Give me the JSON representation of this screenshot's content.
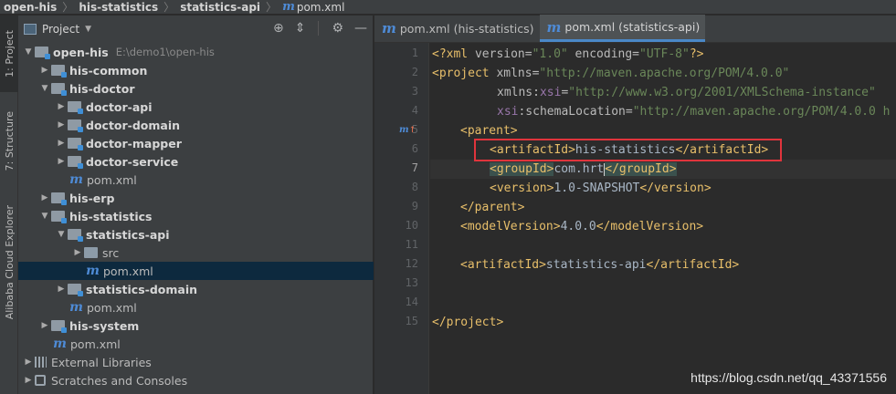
{
  "breadcrumb": {
    "items": [
      "open-his",
      "his-statistics",
      "statistics-api",
      "pom.xml"
    ]
  },
  "tool_stripe": {
    "tabs": [
      "1: Project",
      "7: Structure",
      "Alibaba Cloud Explorer"
    ]
  },
  "project_panel": {
    "title": "Project",
    "tree": [
      {
        "label": "open-his",
        "path": "E:\\demo1\\open-his"
      },
      {
        "label": "his-common"
      },
      {
        "label": "his-doctor"
      },
      {
        "label": "doctor-api"
      },
      {
        "label": "doctor-domain"
      },
      {
        "label": "doctor-mapper"
      },
      {
        "label": "doctor-service"
      },
      {
        "label": "pom.xml"
      },
      {
        "label": "his-erp"
      },
      {
        "label": "his-statistics"
      },
      {
        "label": "statistics-api"
      },
      {
        "label": "src"
      },
      {
        "label": "pom.xml"
      },
      {
        "label": "statistics-domain"
      },
      {
        "label": "pom.xml"
      },
      {
        "label": "his-system"
      },
      {
        "label": "pom.xml"
      },
      {
        "label": "External Libraries"
      },
      {
        "label": "Scratches and Consoles"
      }
    ]
  },
  "editor": {
    "tabs": [
      "pom.xml (his-statistics)",
      "pom.xml (statistics-api)"
    ],
    "active_tab": 1,
    "line_numbers": [
      "1",
      "2",
      "3",
      "4",
      "5",
      "6",
      "7",
      "8",
      "9",
      "10",
      "11",
      "12",
      "13",
      "14",
      "15"
    ],
    "gutter_marker": "m",
    "code": {
      "l1_decl": "<?xml",
      "l1_attr1": " version=",
      "l1_val1": "\"1.0\"",
      "l1_attr2": " encoding=",
      "l1_val2": "\"UTF-8\"",
      "l1_end": "?>",
      "l2_tag": "<project",
      "l2_attr": " xmlns=",
      "l2_val": "\"http://maven.apache.org/POM/4.0.0\"",
      "l3_attr": "xmlns:",
      "l3_ns": "xsi",
      "l3_eq": "=",
      "l3_val": "\"http://www.w3.org/2001/XMLSchema-instance\"",
      "l4_ns": "xsi",
      "l4_attr": ":schemaLocation=",
      "l4_val": "\"http://maven.apache.org/POM/4.0.0 h",
      "l5_tag": "<parent>",
      "l6_open": "<artifactId>",
      "l6_text": "his-statistics",
      "l6_close": "</artifactId>",
      "l7_open": "<groupId>",
      "l7_text": "com.hrt",
      "l7_close": "</groupId>",
      "l8_open": "<version>",
      "l8_text": "1.0-SNAPSHOT",
      "l8_close": "</version>",
      "l9_tag": "</parent>",
      "l10_open": "<modelVersion>",
      "l10_text": "4.0.0",
      "l10_close": "</modelVersion>",
      "l12_open": "<artifactId>",
      "l12_text": "statistics-api",
      "l12_close": "</artifactId>",
      "l15_tag": "</project>"
    }
  },
  "watermark": "https://blog.csdn.net/qq_43371556",
  "colors": {
    "tag": "#e8bf6a",
    "value": "#6a8759",
    "namespace": "#9876aa",
    "highlight_box": "#e0343c",
    "selection": "#0d293e"
  }
}
